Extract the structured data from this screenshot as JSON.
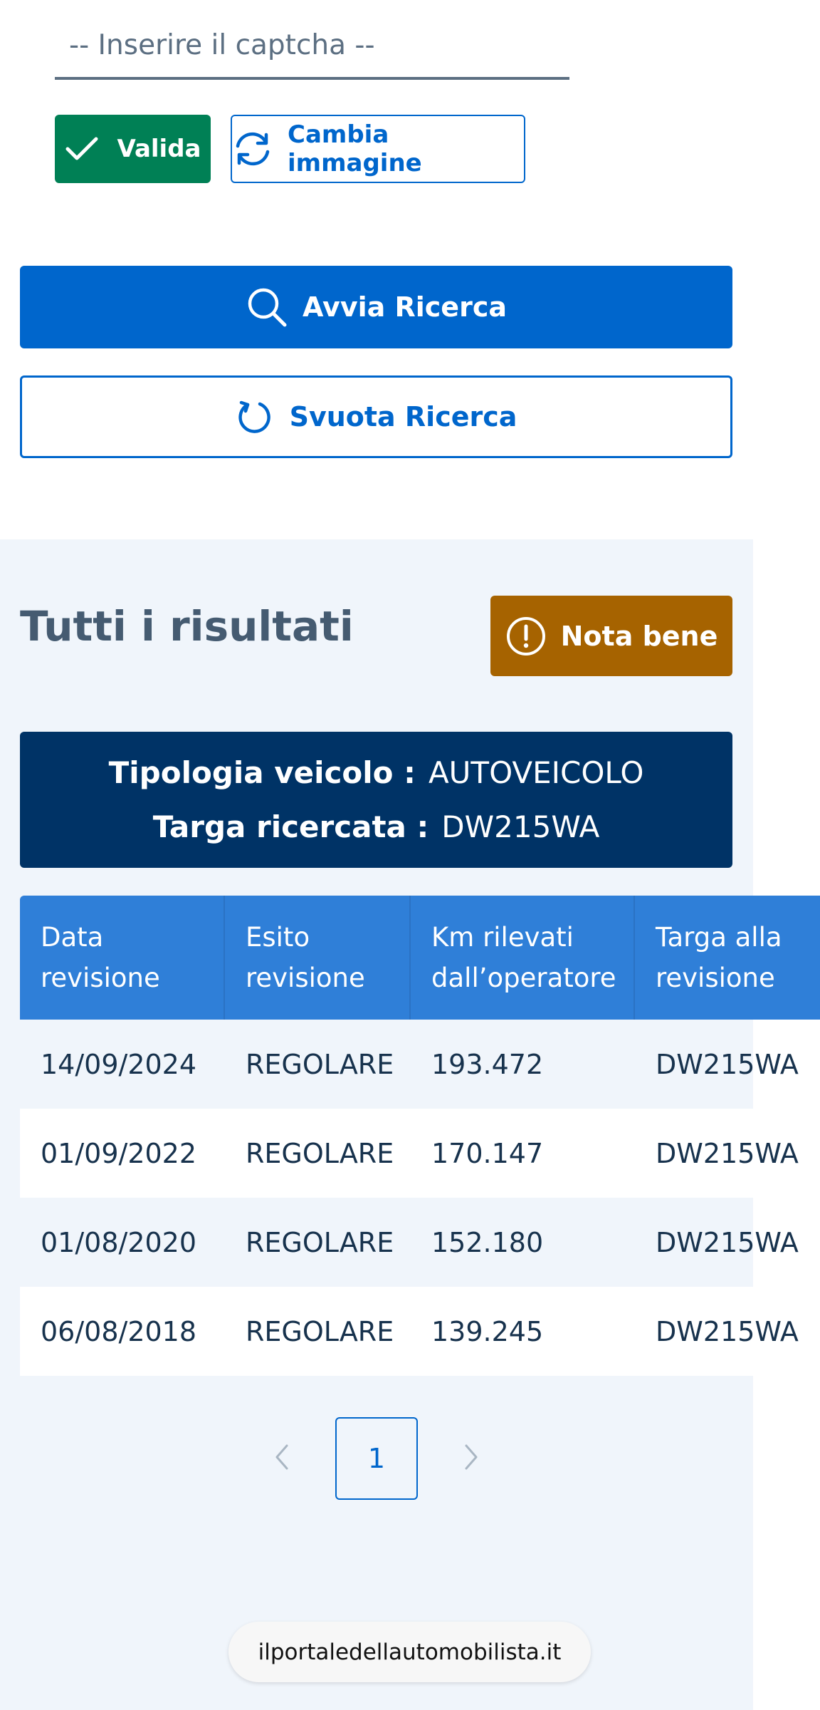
{
  "captcha": {
    "placeholder": "-- Inserire il captcha --"
  },
  "buttons": {
    "valida": "Valida",
    "cambia_immagine": "Cambia immagine",
    "avvia_ricerca": "Avvia Ricerca",
    "svuota_ricerca": "Svuota Ricerca",
    "nota_bene": "Nota bene"
  },
  "results": {
    "title": "Tutti i risultati",
    "vehicle": {
      "tipologia_label": "Tipologia veicolo :",
      "tipologia_value": "AUTOVEICOLO",
      "targa_label": "Targa ricercata :",
      "targa_value": "DW215WA"
    },
    "table": {
      "headers": [
        [
          "Data",
          "revisione"
        ],
        [
          "Esito",
          "revisione"
        ],
        [
          "Km rilevati",
          "dall’operatore"
        ],
        [
          "Targa alla",
          "revisione"
        ]
      ],
      "rows": [
        [
          "14/09/2024",
          "REGOLARE",
          "193.472",
          "DW215WA"
        ],
        [
          "01/09/2022",
          "REGOLARE",
          "170.147",
          "DW215WA"
        ],
        [
          "01/08/2020",
          "REGOLARE",
          "152.180",
          "DW215WA"
        ],
        [
          "06/08/2018",
          "REGOLARE",
          "139.245",
          "DW215WA"
        ]
      ]
    },
    "pagination": {
      "current_page": "1"
    }
  },
  "browser": {
    "url": "ilportaledellautomobilista.it"
  },
  "colors": {
    "primary": "#0066cc",
    "success": "#008055",
    "warning": "#a66300",
    "dark_navy": "#003366",
    "table_header": "#2f7fd8",
    "section_bg": "#f0f5fb"
  },
  "icons": {
    "valida": "check-icon",
    "cambia": "refresh-icon",
    "avvia": "search-icon",
    "svuota": "reset-icon",
    "nota": "alert-circle-icon",
    "prev": "chevron-left-icon",
    "next": "chevron-right-icon"
  }
}
